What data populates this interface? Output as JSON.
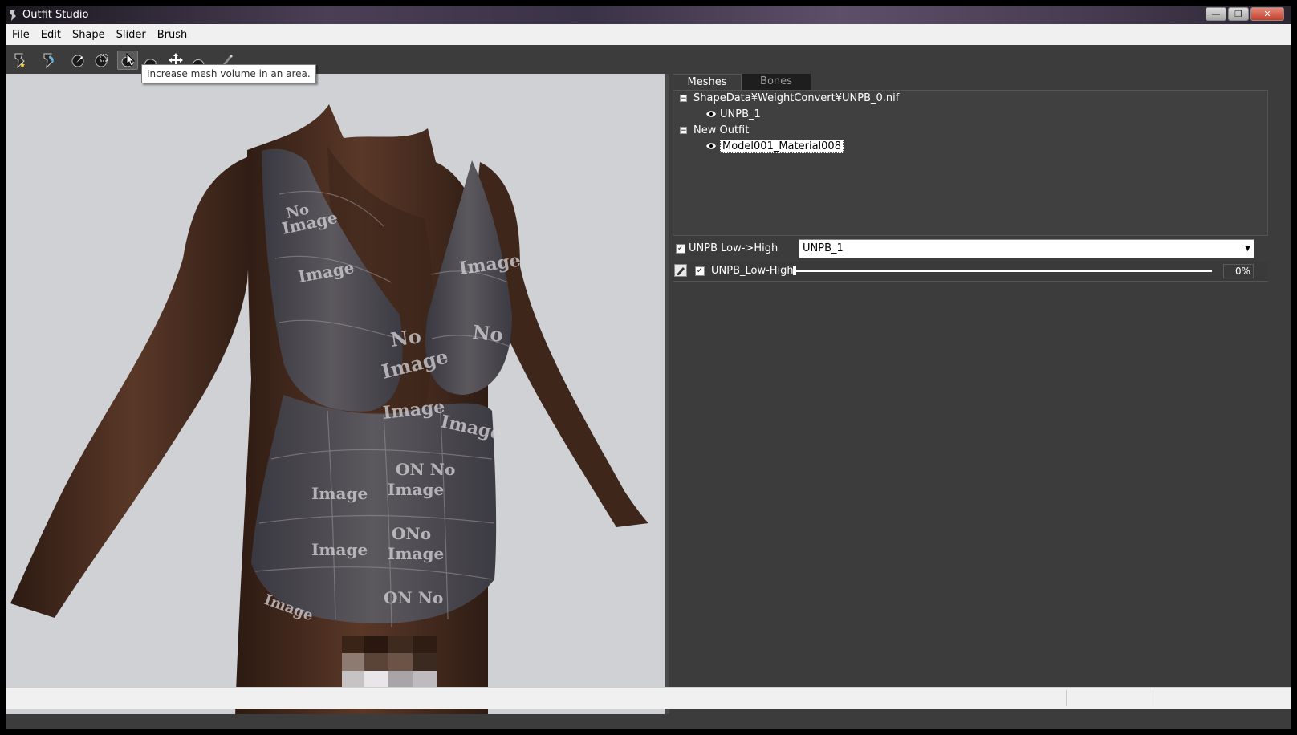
{
  "window": {
    "title": "Outfit Studio",
    "buttons": {
      "minimize": "—",
      "maximize": "❐",
      "close": "✕"
    }
  },
  "menu": [
    "File",
    "Edit",
    "Shape",
    "Slider",
    "Brush"
  ],
  "toolbar": {
    "tools": [
      "new-project-icon",
      "load-project-icon",
      "select-brush-icon",
      "mask-brush-icon",
      "inflate-brush-icon",
      "deflate-brush-icon",
      "move-brush-icon",
      "smooth-brush-icon",
      "weight-brush-icon"
    ],
    "active_tool": "inflate-brush-icon",
    "tooltip": "Increase mesh volume in an area."
  },
  "panel": {
    "tabs": {
      "meshes": "Meshes",
      "bones": "Bones"
    },
    "tree": {
      "groups": [
        {
          "label": "ShapeData¥WeightConvert¥UNPB_0.nif",
          "expander": "−",
          "children": [
            "UNPB_1"
          ]
        },
        {
          "label": "New Outfit",
          "expander": "−",
          "children": [
            "Model001_Material008"
          ]
        }
      ],
      "selected": "Model001_Material008"
    },
    "slider_set": {
      "label": "UNPB Low->High",
      "checked": true,
      "selected_value": "UNPB_1",
      "dropdown_arrow": "▼"
    },
    "slider": {
      "name": "UNPB_Low-High",
      "value_text": "0%",
      "value": 0,
      "checked": true
    }
  },
  "check_mark": "✓",
  "colors": {
    "panel_bg": "#3c3c3c",
    "viewport_bg": "#cfd1d5",
    "skin": "#4a2e22",
    "outfit": "#4d4a4f"
  }
}
